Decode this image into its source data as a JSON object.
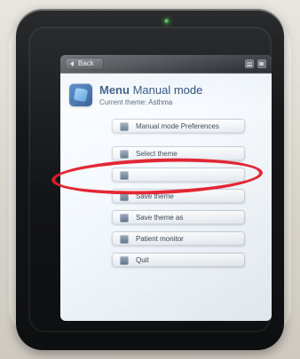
{
  "device": {
    "screen": {
      "top_bar": {
        "back_label": "Back",
        "center_text": "",
        "icons": [
          "network-icon",
          "menu-icon",
          "battery-icon"
        ]
      },
      "header": {
        "title_strong": "Menu",
        "title_rest": " Manual mode",
        "subtitle": "Current theme: Asthma"
      },
      "menu_items": [
        {
          "label": "Manual mode Preferences",
          "icon": "preferences-icon"
        },
        {
          "label": "Select theme",
          "icon": "select-theme-icon"
        },
        {
          "label": "",
          "icon": "blank-icon"
        },
        {
          "label": "Save theme",
          "icon": "save-icon"
        },
        {
          "label": "Save theme as",
          "icon": "save-as-icon"
        },
        {
          "label": "Patient monitor",
          "icon": "patient-monitor-icon"
        },
        {
          "label": "Quit",
          "icon": "quit-icon"
        }
      ],
      "highlight": {
        "color": "#e21d2b"
      }
    }
  }
}
